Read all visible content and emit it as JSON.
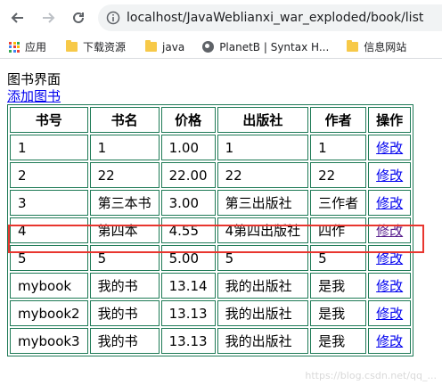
{
  "browser": {
    "url": "localhost/JavaWeblianxi_war_exploded/book/list",
    "bookmarks": [
      {
        "label": "应用",
        "icon": "apps-icon"
      },
      {
        "label": "下载资源",
        "icon": "folder-icon"
      },
      {
        "label": "java",
        "icon": "folder-icon"
      },
      {
        "label": "PlanetB | Syntax H...",
        "icon": "globe-icon"
      },
      {
        "label": "信息网站",
        "icon": "folder-icon"
      }
    ]
  },
  "page": {
    "title": "图书界面",
    "add_link": "添加图书"
  },
  "table": {
    "headers": [
      "书号",
      "书名",
      "价格",
      "出版社",
      "作者",
      "操作"
    ],
    "rows": [
      [
        "1",
        "1",
        "1.00",
        "1",
        "1",
        "修改"
      ],
      [
        "2",
        "22",
        "22.00",
        "22",
        "22",
        "修改"
      ],
      [
        "3",
        "第三本书",
        "3.00",
        "第三出版社",
        "三作者",
        "修改"
      ],
      [
        "4",
        "第四本",
        "4.55",
        "4第四出版社",
        "四作",
        "修改"
      ],
      [
        "5",
        "5",
        "5.00",
        "5",
        "5",
        "修改"
      ],
      [
        "mybook",
        "我的书",
        "13.14",
        "我的出版社",
        "是我",
        "修改"
      ],
      [
        "mybook2",
        "我的书",
        "13.13",
        "我的出版社",
        "是我",
        "修改"
      ],
      [
        "mybook3",
        "我的书",
        "13.13",
        "我的出版社",
        "是我",
        "修改"
      ]
    ]
  },
  "colors": {
    "table_border": "#1e7a56",
    "highlight": "#e8362f",
    "link": "#0000ee"
  },
  "watermark": "https://blog.csdn.net/qq_..."
}
